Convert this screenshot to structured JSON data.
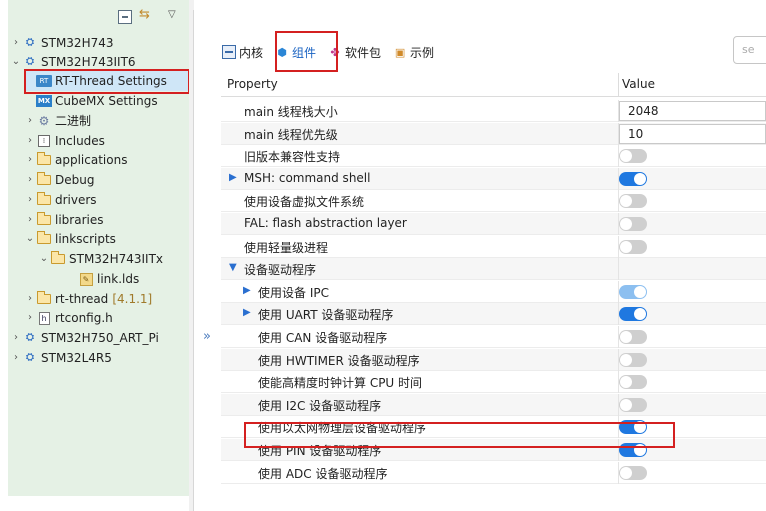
{
  "explorer": {
    "toolbar": {
      "collapse_icon": "collapse-all-icon",
      "link_icon": "link-with-editor-icon",
      "menu_glyph": "▽"
    },
    "tree": [
      {
        "label": "STM32H743",
        "arrow": "›",
        "icon": "project-icon",
        "suffix": ""
      },
      {
        "label": "STM32H743IIT6",
        "arrow": "⌄",
        "icon": "project-icon",
        "suffix": ""
      },
      {
        "label": "RT-Thread Settings",
        "arrow": "",
        "icon": "rt-thread-settings-icon",
        "suffix": ""
      },
      {
        "label": "CubeMX Settings",
        "arrow": "",
        "icon": "cubemx-icon",
        "suffix": ""
      },
      {
        "label": "二进制",
        "arrow": "›",
        "icon": "binaries-icon",
        "suffix": ""
      },
      {
        "label": "Includes",
        "arrow": "›",
        "icon": "includes-icon",
        "suffix": ""
      },
      {
        "label": "applications",
        "arrow": "›",
        "icon": "folder-icon",
        "suffix": ""
      },
      {
        "label": "Debug",
        "arrow": "›",
        "icon": "folder-icon",
        "suffix": ""
      },
      {
        "label": "drivers",
        "arrow": "›",
        "icon": "folder-icon",
        "suffix": ""
      },
      {
        "label": "libraries",
        "arrow": "›",
        "icon": "folder-icon",
        "suffix": ""
      },
      {
        "label": "linkscripts",
        "arrow": "⌄",
        "icon": "folder-icon",
        "suffix": ""
      },
      {
        "label": "STM32H743IITx",
        "arrow": "⌄",
        "icon": "folder-icon",
        "suffix": ""
      },
      {
        "label": "link.lds",
        "arrow": "",
        "icon": "linker-file-icon",
        "suffix": ""
      },
      {
        "label": "rt-thread",
        "arrow": "›",
        "icon": "folder-icon",
        "suffix": "[4.1.1]"
      },
      {
        "label": "rtconfig.h",
        "arrow": "›",
        "icon": "header-file-icon",
        "suffix": ""
      },
      {
        "label": "STM32H750_ART_Pi",
        "arrow": "›",
        "icon": "project-icon",
        "suffix": ""
      },
      {
        "label": "STM32L4R5",
        "arrow": "›",
        "icon": "project-icon",
        "suffix": ""
      }
    ],
    "highlight_color": "#d42020"
  },
  "splitter": {
    "expand_glyph": "»"
  },
  "tabs": [
    {
      "label": "内核",
      "icon": "kernel-icon"
    },
    {
      "label": "组件",
      "icon": "component-icon"
    },
    {
      "label": "软件包",
      "icon": "packages-icon"
    },
    {
      "label": "示例",
      "icon": "examples-icon"
    }
  ],
  "search": {
    "placeholder": "se"
  },
  "grid": {
    "header": {
      "property": "Property",
      "value": "Value"
    },
    "rows": [
      {
        "label": "main 线程栈大小",
        "type": "input",
        "value": "2048"
      },
      {
        "label": "main 线程优先级",
        "type": "input",
        "value": "10"
      },
      {
        "label": "旧版本兼容性支持",
        "type": "toggle",
        "state": "off"
      },
      {
        "label": "MSH: command shell",
        "type": "toggle",
        "state": "on",
        "expandable": "collapsed"
      },
      {
        "label": "使用设备虚拟文件系统",
        "type": "toggle",
        "state": "off"
      },
      {
        "label": "FAL: flash abstraction layer",
        "type": "toggle",
        "state": "off"
      },
      {
        "label": "使用轻量级进程",
        "type": "toggle",
        "state": "off"
      },
      {
        "label": "设备驱动程序",
        "type": "group",
        "expandable": "expanded"
      },
      {
        "label": "使用设备 IPC",
        "type": "toggle",
        "state": "on-light",
        "expandable": "collapsed",
        "indent": 1
      },
      {
        "label": "使用 UART 设备驱动程序",
        "type": "toggle",
        "state": "on",
        "expandable": "collapsed",
        "indent": 1
      },
      {
        "label": "使用 CAN 设备驱动程序",
        "type": "toggle",
        "state": "off",
        "indent": 1
      },
      {
        "label": "使用 HWTIMER 设备驱动程序",
        "type": "toggle",
        "state": "off",
        "indent": 1
      },
      {
        "label": "使能高精度时钟计算 CPU 时间",
        "type": "toggle",
        "state": "off",
        "indent": 1
      },
      {
        "label": "使用 I2C 设备驱动程序",
        "type": "toggle",
        "state": "off",
        "indent": 1
      },
      {
        "label": "使用以太网物理层设备驱动程序",
        "type": "toggle",
        "state": "on",
        "indent": 1
      },
      {
        "label": "使用 PIN 设备驱动程序",
        "type": "toggle",
        "state": "on",
        "indent": 1
      },
      {
        "label": "使用 ADC 设备驱动程序",
        "type": "toggle",
        "state": "off",
        "indent": 1
      }
    ]
  },
  "colors": {
    "explorer_bg": "#e5f1e5",
    "toggle_on": "#1f78e0",
    "toggle_off": "#cfcfcf",
    "highlight": "#d42020"
  }
}
